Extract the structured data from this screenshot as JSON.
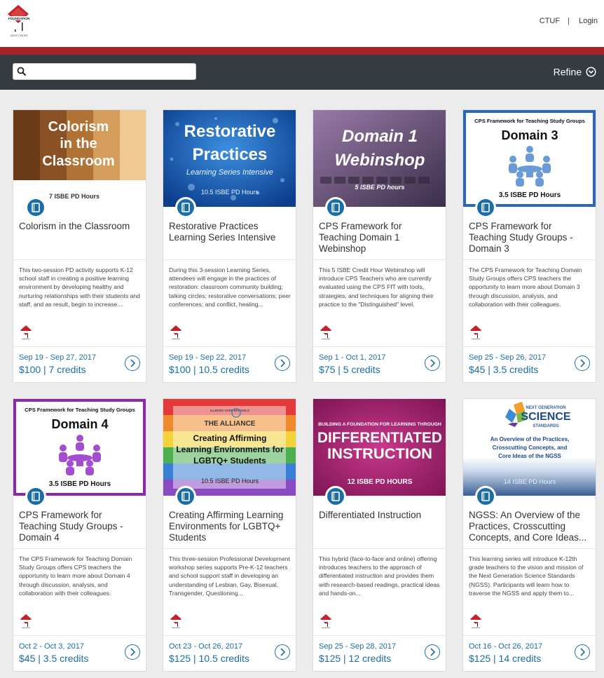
{
  "header": {
    "brand_name": "FOUNDATION",
    "brand_sub": "QUEST CENTER",
    "link_ctuf": "CTUF",
    "separator": "|",
    "link_login": "Login"
  },
  "search": {
    "placeholder": "",
    "value": ""
  },
  "refine_label": "Refine",
  "colors": {
    "accent": "#1a6ea5",
    "brand_red": "#a8222a",
    "bar_dark": "#343b41"
  },
  "cards": [
    {
      "image_text": [
        "Colorism",
        "in the",
        "Classroom",
        "7 ISBE PD Hours"
      ],
      "title": "Colorism in the Classroom",
      "description": "This two-session PD activity supports K-12 school staff in creating a positive learning environment by developing healthy and nurturing relationships with their students and staff, and as result, begin to increase...",
      "date": "Sep 19 - Sep 27, 2017",
      "price": "$100 | 7 credits",
      "icon": "book-icon"
    },
    {
      "image_text": [
        "Restorative",
        "Practices",
        "Learning Series Intensive",
        "10.5 ISBE PD Hours"
      ],
      "title": "Restorative Practices Learning Series Intensive",
      "description": "During this 3-session Learning Series, attendees will engage in the practices of restoration: classroom community building; talking circles; restorative conversations; peer conferences; and conflict, healing...",
      "date": "Sep 19 - Sep 22, 2017",
      "price": "$100 | 10.5 credits",
      "icon": "book-icon"
    },
    {
      "image_text": [
        "Domain 1",
        "Webinshop",
        "5 ISBE PD hours"
      ],
      "title": "CPS Framework for Teaching Domain 1 Webinshop",
      "description": "This 5 ISBE Credit Hour Webinshop will introduce CPS Teachers who are currently evaluated using the CPS FfT with tools, strategies, and techniques for aligning their practice to the \"Distinguished\" level.",
      "date": "Sep 1 - Oct 1, 2017",
      "price": "$75 | 5 credits",
      "icon": "book-icon"
    },
    {
      "image_text": [
        "CPS Framework for Teaching Study Groups",
        "Domain 3",
        "3.5 ISBE PD Hours"
      ],
      "title": "CPS Framework for Teaching Study Groups - Domain 3",
      "description": "The CPS Framework for Teaching Domain Study Groups offers CPS teachers the opportunity to learn more about Domain 3 through discussion, analysis, and collaboration with their colleagues.",
      "date": "Sep 25 - Sep 26, 2017",
      "price": "$45 | 3.5 credits",
      "icon": "book-icon"
    },
    {
      "image_text": [
        "CPS Framework for Teaching Study Groups",
        "Domain 4",
        "3.5 ISBE PD Hours"
      ],
      "title": "CPS Framework for Teaching Study Groups - Domain 4",
      "description": "The CPS Framework for Teaching Domain Study Groups offers CPS teachers the opportunity to learn more about Domain 4 through discussion, analysis, and collaboration with their colleagues.",
      "date": "Oct 2 - Oct 3, 2017",
      "price": "$45 | 3.5 credits",
      "icon": "book-icon"
    },
    {
      "image_text": [
        "ILLINOIS SAFE SCHOOLS",
        "THE ALLIANCE",
        "Creating Affirming",
        "Learning Environments for",
        "LGBTQ+ Students",
        "10.5 ISBE PD Hours"
      ],
      "title": "Creating Affirming Learning Environments for LGBTQ+ Students",
      "description": "This three-session Professional Development workshop series supports Pre-K-12 teachers and school support staff in developing an understanding of Lesbian, Gay, Bisexual, Transgender, Questioning...",
      "date": "Oct 23 - Oct 26, 2017",
      "price": "$125 | 10.5 credits",
      "icon": "book-icon"
    },
    {
      "image_text": [
        "BUILDING A FOUNDATION FOR LEARNING THROUGH",
        "DIFFERENTIATED",
        "INSTRUCTION",
        "12 ISBE PD HOURS"
      ],
      "title": "Differentiated Instruction",
      "description": "This hybrid (face-to-face and online) offering introduces teachers to the approach of differentiated instruction and provides them with research-based readings, practical ideas and hands-on...",
      "date": "Sep 25 - Sep 28, 2017",
      "price": "$125 | 12 credits",
      "icon": "book-icon"
    },
    {
      "image_text": [
        "NEXT GENERATION",
        "SCIENCE",
        "STANDARDS",
        "An Overview of the Practices,",
        "Crosscutting Concepts, and",
        "Core Ideas of the NGSS",
        "14 ISBE PD Hours"
      ],
      "title": "NGSS: An Overview of the Practices, Crosscutting Concepts, and Core Ideas...",
      "description": "This learning series will introduce K-12th grade teachers to the vision and mission of the Next Generation Science Standards (NGSS). Participants will learn how to traverse the NGSS and apply them to...",
      "date": "Oct 16 - Oct 26, 2017",
      "price": "$125 | 14 credits",
      "icon": "book-icon"
    }
  ]
}
